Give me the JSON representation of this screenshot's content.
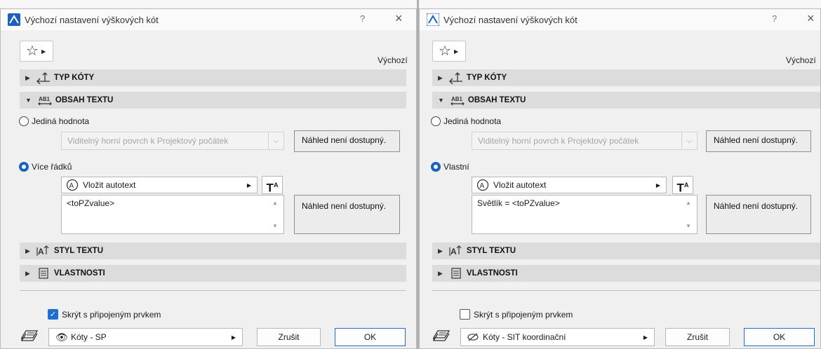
{
  "left": {
    "title": "Výchozí nastavení výškových kót",
    "help": "?",
    "close": "×",
    "preset": "Výchozí",
    "panel_typ": "TYP KÓTY",
    "panel_obsah": "OBSAH TEXTU",
    "radio_single": "Jediná hodnota",
    "combo_single": "Viditelný horní povrch k Projektový počátek",
    "preview_1": "Náhled není dostupný.",
    "radio_multi": "Více řádků",
    "autotext": "Vložit autotext",
    "tbtn": "T",
    "text_value": "<toPZvalue>",
    "preview_2": "Náhled není dostupný.",
    "panel_styl": "STYL TEXTU",
    "panel_vlast": "VLASTNOSTI",
    "hide_label": "Skrýt s připojeným prvkem",
    "hide_checked": true,
    "layer": "Kóty - SP",
    "cancel": "Zrušit",
    "ok": "OK"
  },
  "right": {
    "title": "Výchozí nastavení výškových kót",
    "help": "?",
    "close": "×",
    "preset": "Výchozí",
    "panel_typ": "TYP KÓTY",
    "panel_obsah": "OBSAH TEXTU",
    "radio_single": "Jediná hodnota",
    "combo_single": "Viditelný horní povrch k Projektový počátek",
    "preview_1": "Náhled není dostupný.",
    "radio_multi": "Vlastní",
    "autotext": "Vložit autotext",
    "tbtn": "T",
    "text_value": "Světlík = <toPZvalue>",
    "preview_2": "Náhled není dostupný.",
    "panel_styl": "STYL TEXTU",
    "panel_vlast": "VLASTNOSTI",
    "hide_label": "Skrýt s připojeným prvkem",
    "hide_checked": false,
    "layer": "Kóty - SIT koordinační",
    "cancel": "Zrušit",
    "ok": "OK"
  },
  "colors": {
    "accent": "#1f6fd1",
    "panel": "#dcdcdc",
    "dialog_bg": "#f0f0f0"
  },
  "icons": {
    "favorites": "star-icon",
    "typ": "elevation-dimension-icon",
    "obsah": "text-content-icon",
    "styl": "text-style-icon",
    "vlast": "properties-icon",
    "autotext": "autotext-icon",
    "layer_left": "eye-icon",
    "layer_right": "hidden-eye-icon",
    "layer_pen": "layer-icon"
  }
}
